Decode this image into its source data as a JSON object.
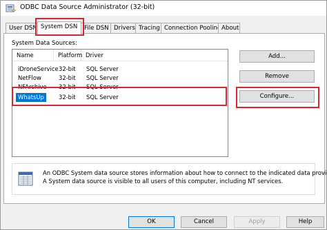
{
  "window": {
    "title": "ODBC Data Source Administrator (32-bit)",
    "icon": "odbc-database-icon"
  },
  "tabs": [
    {
      "label": "User DSN"
    },
    {
      "label": "System DSN",
      "active": true
    },
    {
      "label": "File DSN"
    },
    {
      "label": "Drivers"
    },
    {
      "label": "Tracing"
    },
    {
      "label": "Connection Pooling"
    },
    {
      "label": "About"
    }
  ],
  "system_dsn": {
    "caption": "System Data Sources:",
    "columns": [
      "Name",
      "Platform",
      "Driver"
    ],
    "rows": [
      {
        "name": "iDroneService",
        "platform": "32-bit",
        "driver": "SQL Server"
      },
      {
        "name": "NetFlow",
        "platform": "32-bit",
        "driver": "SQL Server"
      },
      {
        "name": "NFArchive",
        "platform": "32-bit",
        "driver": "SQL Server"
      },
      {
        "name": "WhatsUp",
        "platform": "32-bit",
        "driver": "SQL Server",
        "selected": true
      }
    ],
    "buttons": {
      "add": "Add...",
      "remove": "Remove",
      "configure": "Configure..."
    },
    "info": {
      "icon": "data-source-icon",
      "line1": "An ODBC System data source stores information about how to connect to the indicated data provider.",
      "line2": "A System data source is visible to all users of this computer, including NT services."
    }
  },
  "footer": {
    "ok": "OK",
    "cancel": "Cancel",
    "apply": "Apply",
    "help": "Help"
  },
  "colors": {
    "highlight": "#d9262e",
    "selection": "#0078d7"
  }
}
